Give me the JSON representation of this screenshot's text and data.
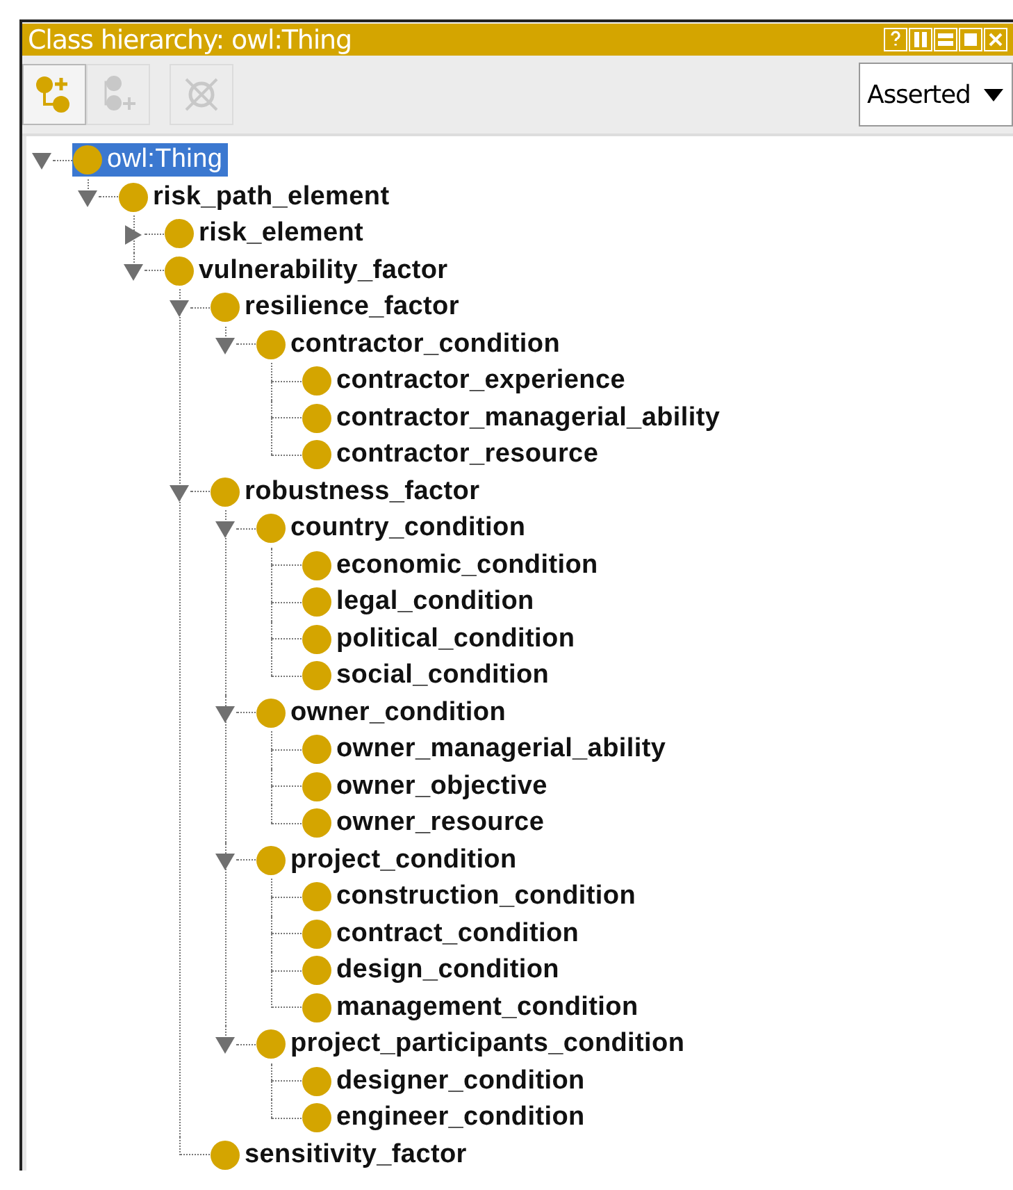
{
  "panel": {
    "title": "Class hierarchy: owl:Thing"
  },
  "toolbar": {
    "buttons": [
      {
        "kind": "add-subclass",
        "disabled": false
      },
      {
        "kind": "add-sibling",
        "disabled": true
      },
      {
        "kind": "delete",
        "disabled": true
      }
    ],
    "view_select": {
      "value": "Asserted"
    }
  },
  "tree": [
    {
      "label": "owl:Thing",
      "selected": true,
      "expanded": true,
      "children": [
        {
          "label": "risk_path_element",
          "selected": false,
          "expanded": true,
          "children": [
            {
              "label": "risk_element",
              "selected": false,
              "expanded": false
            },
            {
              "label": "vulnerability_factor",
              "selected": false,
              "expanded": true,
              "children": [
                {
                  "label": "resilience_factor",
                  "selected": false,
                  "expanded": true,
                  "children": [
                    {
                      "label": "contractor_condition",
                      "selected": false,
                      "expanded": true,
                      "children": [
                        {
                          "label": "contractor_experience",
                          "selected": false
                        },
                        {
                          "label": "contractor_managerial_ability",
                          "selected": false
                        },
                        {
                          "label": "contractor_resource",
                          "selected": false
                        }
                      ]
                    }
                  ]
                },
                {
                  "label": "robustness_factor",
                  "selected": false,
                  "expanded": true,
                  "children": [
                    {
                      "label": "country_condition",
                      "selected": false,
                      "expanded": true,
                      "children": [
                        {
                          "label": "economic_condition",
                          "selected": false
                        },
                        {
                          "label": "legal_condition",
                          "selected": false
                        },
                        {
                          "label": "political_condition",
                          "selected": false
                        },
                        {
                          "label": "social_condition",
                          "selected": false
                        }
                      ]
                    },
                    {
                      "label": "owner_condition",
                      "selected": false,
                      "expanded": true,
                      "children": [
                        {
                          "label": "owner_managerial_ability",
                          "selected": false
                        },
                        {
                          "label": "owner_objective",
                          "selected": false
                        },
                        {
                          "label": "owner_resource",
                          "selected": false
                        }
                      ]
                    },
                    {
                      "label": "project_condition",
                      "selected": false,
                      "expanded": true,
                      "children": [
                        {
                          "label": "construction_condition",
                          "selected": false
                        },
                        {
                          "label": "contract_condition",
                          "selected": false
                        },
                        {
                          "label": "design_condition",
                          "selected": false
                        },
                        {
                          "label": "management_condition",
                          "selected": false
                        }
                      ]
                    },
                    {
                      "label": "project_participants_condition",
                      "selected": false,
                      "expanded": true,
                      "children": [
                        {
                          "label": "designer_condition",
                          "selected": false
                        },
                        {
                          "label": "engineer_condition",
                          "selected": false
                        }
                      ]
                    }
                  ]
                },
                {
                  "label": "sensitivity_factor",
                  "selected": false
                }
              ]
            }
          ]
        }
      ]
    }
  ]
}
